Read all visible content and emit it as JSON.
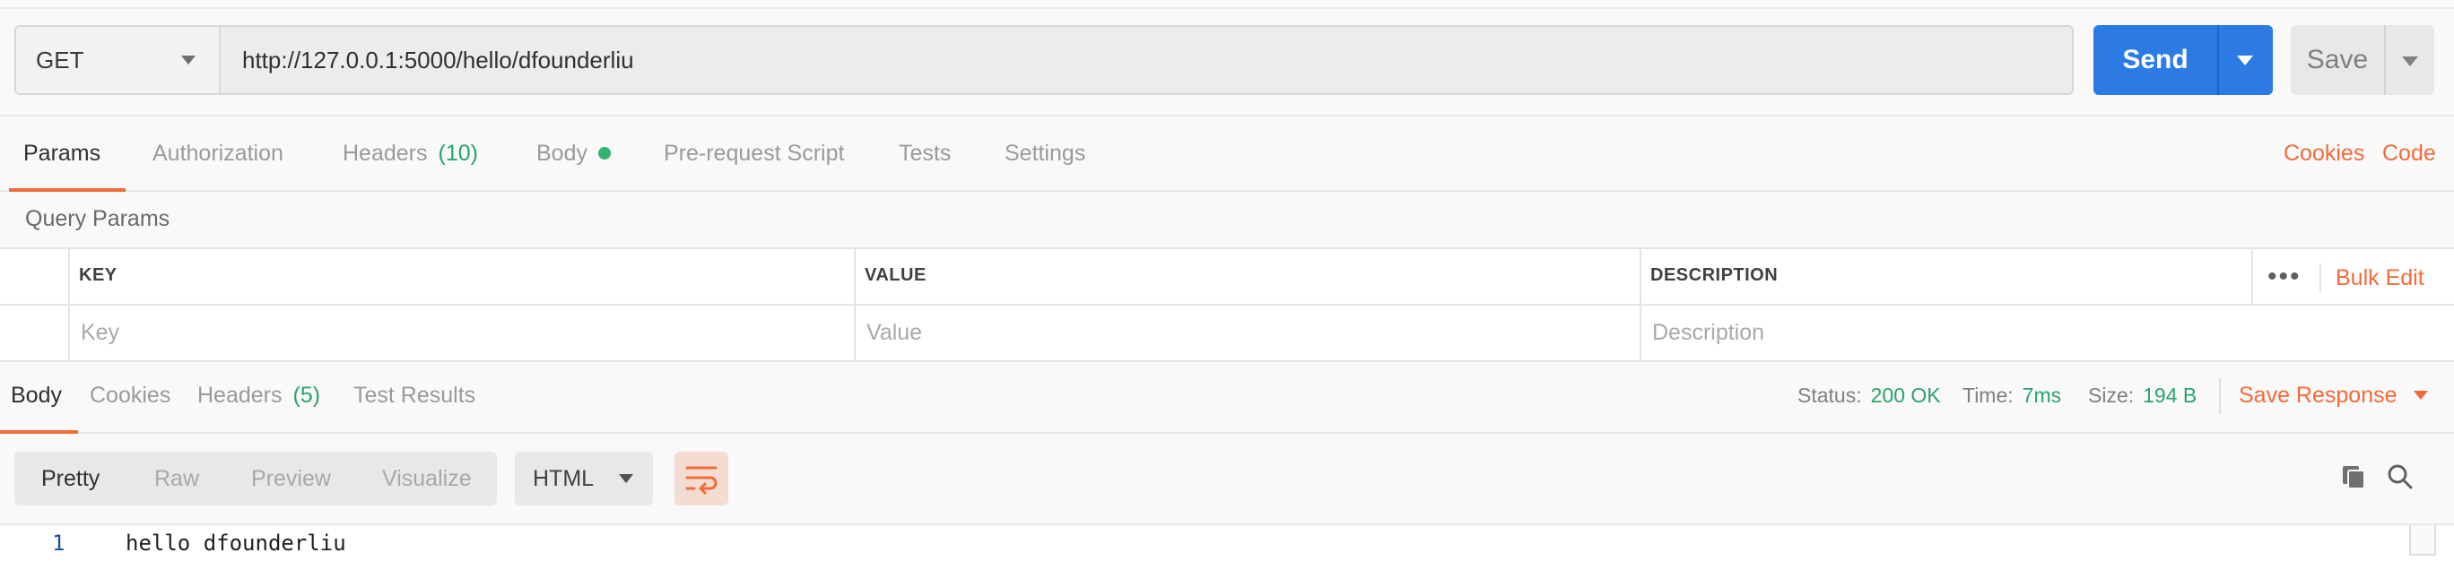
{
  "request": {
    "method": "GET",
    "url": "http://127.0.0.1:5000/hello/dfounderliu",
    "send_label": "Send",
    "save_label": "Save"
  },
  "request_tabs": {
    "params": "Params",
    "authorization": "Authorization",
    "headers": "Headers",
    "headers_count": "(10)",
    "body": "Body",
    "prerequest": "Pre-request Script",
    "tests": "Tests",
    "settings": "Settings",
    "cookies": "Cookies",
    "code": "Code"
  },
  "query_params": {
    "title": "Query Params",
    "columns": [
      "KEY",
      "VALUE",
      "DESCRIPTION"
    ],
    "placeholders": [
      "Key",
      "Value",
      "Description"
    ],
    "more": "•••",
    "bulk_edit": "Bulk Edit"
  },
  "response_tabs": {
    "body": "Body",
    "cookies": "Cookies",
    "headers": "Headers",
    "headers_count": "(5)",
    "test_results": "Test Results"
  },
  "response_status": {
    "status_label": "Status:",
    "status_value": "200 OK",
    "time_label": "Time:",
    "time_value": "7ms",
    "size_label": "Size:",
    "size_value": "194 B",
    "save_response": "Save Response"
  },
  "view": {
    "modes": [
      "Pretty",
      "Raw",
      "Preview",
      "Visualize"
    ],
    "active_mode": "Pretty",
    "format": "HTML"
  },
  "response_body": {
    "line_number": "1",
    "line_text": "hello dfounderliu"
  },
  "colors": {
    "accent": "#f26b3a",
    "send": "#2c7be5",
    "success": "#2aa36b"
  }
}
